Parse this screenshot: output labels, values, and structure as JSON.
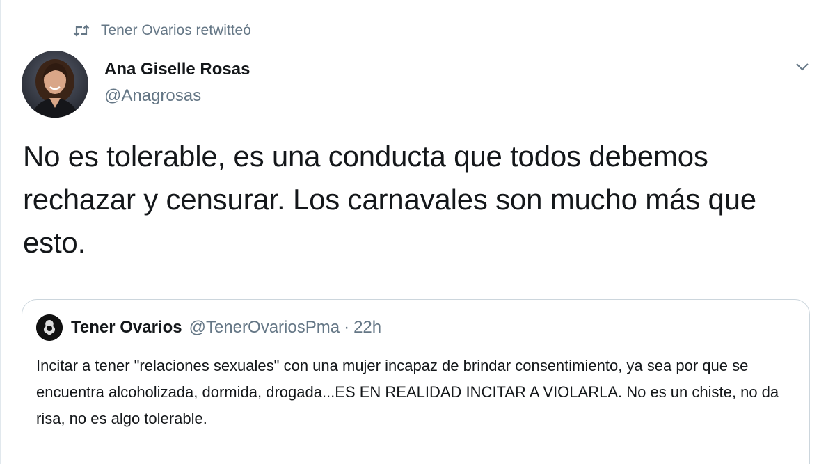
{
  "retweet": {
    "icon": "retweet-icon",
    "text": "Tener Ovarios retwitteó"
  },
  "tweet": {
    "author_name": "Ana Giselle Rosas",
    "author_handle": "@Anagrosas",
    "avatar_icon": "avatar-photo",
    "caret_icon": "chevron-down-icon",
    "text": "No es tolerable, es una conducta que todos debemos rechazar y censurar. Los carnavales son mucho más que esto."
  },
  "quote": {
    "author_name": "Tener Ovarios",
    "author_handle": "@TenerOvariosPma",
    "separator": "·",
    "time": "22h",
    "text": "Incitar a tener \"relaciones sexuales\" con una mujer incapaz de brindar consentimiento, ya sea por que se encuentra alcoholizada, dormida, drogada...ES EN REALIDAD INCITAR A VIOLARLA. No es un chiste, no da risa, no es algo tolerable."
  },
  "colors": {
    "text_primary": "#14171a",
    "text_secondary": "#657786",
    "border": "#ccd6dd"
  }
}
